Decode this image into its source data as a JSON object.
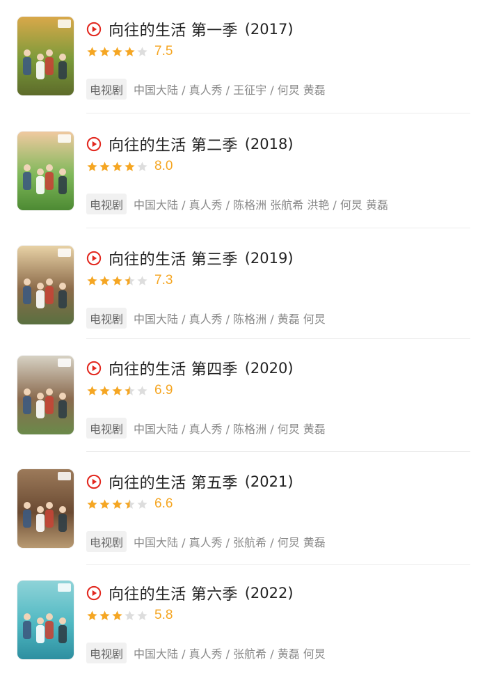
{
  "colors": {
    "accent_red": "#e2271e",
    "star_gold": "#f5a623",
    "star_empty": "#dddddd",
    "tag_bg": "#f1f1f1",
    "meta_text": "#888888"
  },
  "icons": {
    "play": "play-circle-icon",
    "star": "star-icon"
  },
  "items": [
    {
      "title": "向往的生活 第一季",
      "year": "(2017)",
      "stars": 4,
      "score": "7.5",
      "type": "电视剧",
      "meta": "中国大陆 / 真人秀 / 王征宇 / 何炅 黄磊",
      "poster_theme": [
        "#d9a84a",
        "#7a9a3a",
        "#5d6b2a"
      ]
    },
    {
      "title": "向往的生活 第二季",
      "year": "(2018)",
      "stars": 4,
      "score": "8.0",
      "type": "电视剧",
      "meta": "中国大陆 / 真人秀 / 陈格洲 张航希 洪艳 / 何炅 黄磊",
      "poster_theme": [
        "#f0c9a0",
        "#7fb85a",
        "#4d8a33"
      ]
    },
    {
      "title": "向往的生活 第三季",
      "year": "(2019)",
      "stars": 3.5,
      "score": "7.3",
      "type": "电视剧",
      "meta": "中国大陆 / 真人秀 / 陈格洲 / 黄磊 何炅",
      "poster_theme": [
        "#e8d2a6",
        "#8c6b4a",
        "#5a7040"
      ]
    },
    {
      "title": "向往的生活 第四季",
      "year": "(2020)",
      "stars": 3.5,
      "score": "6.9",
      "type": "电视剧",
      "meta": "中国大陆 / 真人秀 / 陈格洲 / 何炅 黄磊",
      "poster_theme": [
        "#d7d2c4",
        "#8a6a4e",
        "#6a8a4a"
      ]
    },
    {
      "title": "向往的生活 第五季",
      "year": "(2021)",
      "stars": 3.5,
      "score": "6.6",
      "type": "电视剧",
      "meta": "中国大陆 / 真人秀 / 张航希 / 何炅 黄磊",
      "poster_theme": [
        "#9c7a5a",
        "#6a4a32",
        "#b89a72"
      ]
    },
    {
      "title": "向往的生活 第六季",
      "year": "(2022)",
      "stars": 3,
      "score": "5.8",
      "type": "电视剧",
      "meta": "中国大陆 / 真人秀 / 张航希 / 黄磊 何炅",
      "poster_theme": [
        "#8fd3d8",
        "#4fb8c2",
        "#2e8fa0"
      ]
    }
  ]
}
